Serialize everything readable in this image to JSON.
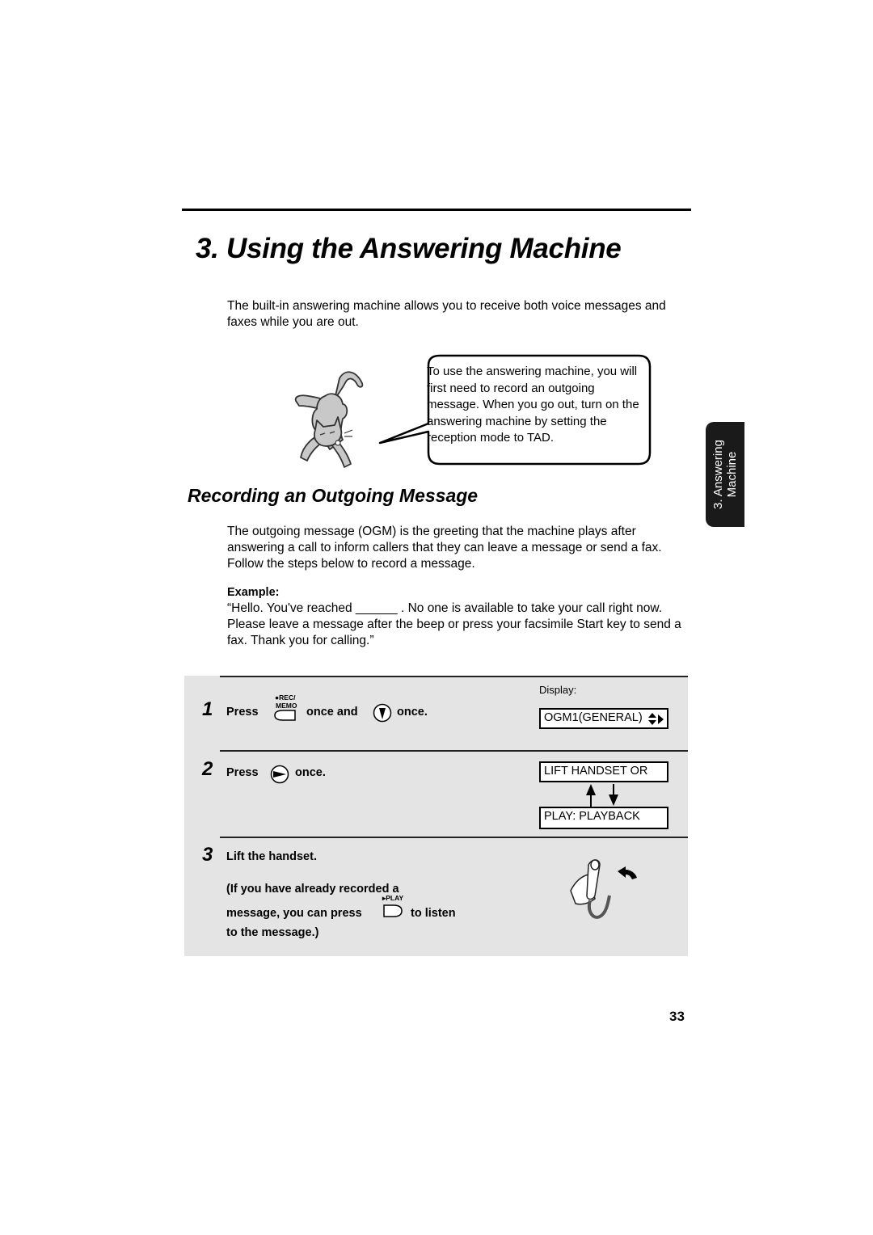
{
  "chapter": {
    "title": "3.  Using the Answering Machine",
    "intro": "The built-in answering machine allows you to receive both voice messages and faxes while you are out."
  },
  "callout": {
    "text": "To use the answering machine, you will first need to record an outgoing message. When you go out, turn on the answering machine by setting the reception mode to TAD."
  },
  "side_tab": {
    "line1": "3. Answering",
    "line2": "Machine"
  },
  "section": {
    "title": "Recording an Outgoing Message",
    "body": "The outgoing message (OGM) is the greeting that the machine plays after answering a call to inform callers that they can leave a message or send a fax. Follow the steps below to record a message.",
    "example_label": "Example:",
    "example_text": "“Hello. You've reached ______ . No one is available to take your call right now. Please leave a message after the beep or press your facsimile Start key to send a fax. Thank you for calling.”"
  },
  "steps": [
    {
      "number": "1",
      "press": "Press",
      "key_label_top": "●REC/",
      "key_label_bottom": "MEMO",
      "mid": "once and",
      "end": "once.",
      "display_label": "Display:",
      "display": "OGM1(GENERAL)"
    },
    {
      "number": "2",
      "press": "Press",
      "end": "once.",
      "display_a": "LIFT HANDSET OR",
      "display_b": "PLAY: PLAYBACK"
    },
    {
      "number": "3",
      "line1": "Lift the handset.",
      "line2": "(If you have already recorded a",
      "line3a": "message, you can press",
      "key_label": "▸PLAY",
      "line3b": "to listen",
      "line4": "to the message.)"
    }
  ],
  "page_number": "33"
}
